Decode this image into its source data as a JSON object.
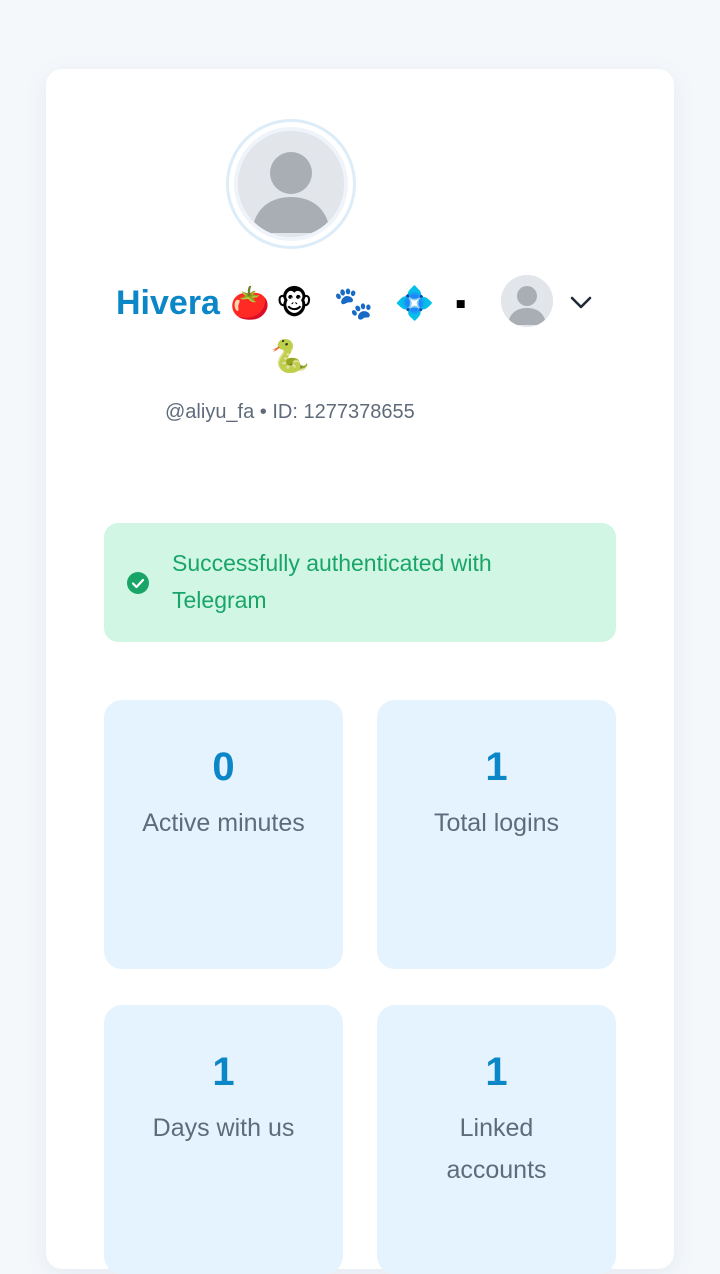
{
  "profile": {
    "name": "Hivera",
    "emojis_line1": "🍅🐵 🐾 💠 ▪",
    "emojis_line2": "🐍",
    "handle_line": "@aliyu_fa • ID: 1277378655"
  },
  "alert": {
    "message": "Successfully authenticated with Telegram",
    "color": "#19a568",
    "background": "#d1f7e4"
  },
  "stats": [
    {
      "value": "0",
      "label": "Active minutes"
    },
    {
      "value": "1",
      "label": "Total logins"
    },
    {
      "value": "1",
      "label": "Days with us"
    },
    {
      "value": "1",
      "label": "Linked accounts"
    }
  ],
  "icons": {
    "profile_avatar": "default-user-avatar-icon",
    "account_menu_avatar": "user-avatar-icon",
    "dropdown": "chevron-down-icon",
    "alert": "check-circle-icon"
  },
  "colors": {
    "accent": "#0b86c7",
    "stat_card": "#e5f3fe"
  }
}
